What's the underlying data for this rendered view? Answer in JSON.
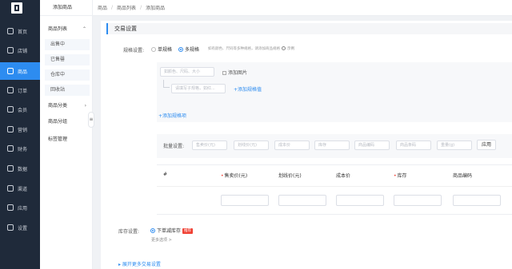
{
  "nav": {
    "items": [
      {
        "label": "首页",
        "icon": "home-icon"
      },
      {
        "label": "店铺",
        "icon": "shop-icon"
      },
      {
        "label": "商品",
        "icon": "goods-icon"
      },
      {
        "label": "订单",
        "icon": "order-icon"
      },
      {
        "label": "会员",
        "icon": "member-icon"
      },
      {
        "label": "营销",
        "icon": "marketing-icon"
      },
      {
        "label": "财务",
        "icon": "finance-icon"
      },
      {
        "label": "数据",
        "icon": "data-icon"
      },
      {
        "label": "渠道",
        "icon": "channel-icon"
      },
      {
        "label": "应用",
        "icon": "apps-icon"
      },
      {
        "label": "设置",
        "icon": "settings-icon"
      }
    ]
  },
  "subnav": {
    "title": "添加商品",
    "group1": "商品列表",
    "sub": [
      "出售中",
      "已售罄",
      "仓库中",
      "回收站"
    ],
    "group2": "商品分类",
    "group3": "商品分组",
    "group4": "标签管理",
    "collapse": "≡"
  },
  "breadcrumb": [
    "商品",
    "商品列表",
    "添加商品"
  ],
  "section_title": "交易设置",
  "spec": {
    "label": "规格设置:",
    "option_single": "单规格",
    "option_multi": "多规格",
    "hint": "如有颜色、尺码等多种规格，请添加商品规格",
    "example": "示例",
    "name_placeholder": "如颜色、尺码、大小",
    "add_image": "添加图片",
    "value_placeholder": "请填写子规格，如红...",
    "add_value": "+添加规格值",
    "add_spec": "+添加规格项"
  },
  "batch": {
    "label": "批量设置:",
    "placeholders": [
      "售卖价(元)",
      "划线价(元)",
      "成本价",
      "库存",
      "商品编码",
      "商品条码",
      "重量(g)"
    ],
    "apply": "应用"
  },
  "table": {
    "headers": [
      "#",
      "售卖价(元)",
      "划线价(元)",
      "成本价",
      "库存",
      "商品编码"
    ]
  },
  "stock": {
    "label": "库存设置:",
    "option": "下单减库存",
    "badge": "推荐",
    "more": "更多选项 >"
  },
  "expand": "展开更多交易设置",
  "colors": {
    "accent": "#2d8cf0",
    "nav_bg": "#1f2a3a",
    "danger": "#f04134"
  }
}
